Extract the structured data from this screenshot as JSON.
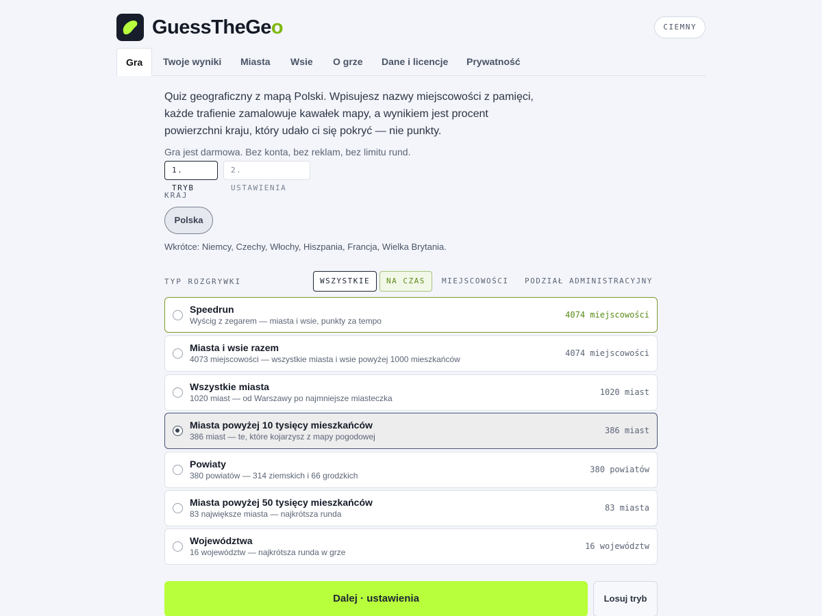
{
  "header": {
    "brand_main": "GuessTheGe",
    "brand_o": "o",
    "theme_button": "CIEMNY",
    "accent_color": "#b8ff3c",
    "logo_icon": "blob-logo-icon"
  },
  "tabs": [
    {
      "label": "Gra",
      "active": true
    },
    {
      "label": "Twoje wyniki"
    },
    {
      "label": "Miasta"
    },
    {
      "label": "Wsie"
    },
    {
      "label": "O grze"
    },
    {
      "label": "Dane i licencje"
    },
    {
      "label": "Prywatność"
    }
  ],
  "intro": "Quiz geograficzny z mapą Polski. Wpisujesz nazwy miejscowości z pamięci, każde trafienie zamalowuje kawałek mapy, a wynikiem jest procent powierzchni kraju, który udało ci się pokryć — nie punkty.",
  "free_note": "Gra jest darmowa. Bez konta, bez reklam, bez limitu rund.",
  "steps": {
    "step1": "1. TRYB",
    "step2": "2. USTAWIENIA"
  },
  "country": {
    "label": "KRAJ",
    "selected": "Polska",
    "soon": "Wkrótce: Niemcy, Czechy, Włochy, Hiszpania, Francja, Wielka Brytania."
  },
  "game_type": {
    "label": "TYP ROZGRYWKI",
    "filters": [
      "WSZYSTKIE",
      "NA CZAS",
      "MIEJSCOWOŚCI",
      "PODZIAŁ ADMINISTRACYJNY"
    ],
    "selected_filter": "WSZYSTKIE"
  },
  "options": [
    {
      "title": "Speedrun",
      "sub": "Wyścig z zegarem — miasta i wsie, punkty za tempo",
      "count": "4074 miejscowości"
    },
    {
      "title": "Miasta i wsie razem",
      "sub": "4073 miejscowości — wszystkie miasta i wsie powyżej 1000 mieszkańców",
      "count": "4074 miejscowości"
    },
    {
      "title": "Wszystkie miasta",
      "sub": "1020 miast — od Warszawy po najmniejsze miasteczka",
      "count": "1020 miast"
    },
    {
      "title": "Miasta powyżej 10 tysięcy mieszkańców",
      "sub": "386 miast — te, które kojarzysz z mapy pogodowej",
      "count": "386 miast",
      "selected": true
    },
    {
      "title": "Powiaty",
      "sub": "380 powiatów — 314 ziemskich i 66 grodzkich",
      "count": "380 powiatów"
    },
    {
      "title": "Miasta powyżej 50 tysięcy mieszkańców",
      "sub": "83 największe miasta — najkrótsza runda",
      "count": "83 miasta"
    },
    {
      "title": "Województwa",
      "sub": "16 województw — najkrótsza runda w grze",
      "count": "16 województw"
    }
  ],
  "actions": {
    "next": "Dalej · ustawienia",
    "random": "Losuj tryb"
  }
}
